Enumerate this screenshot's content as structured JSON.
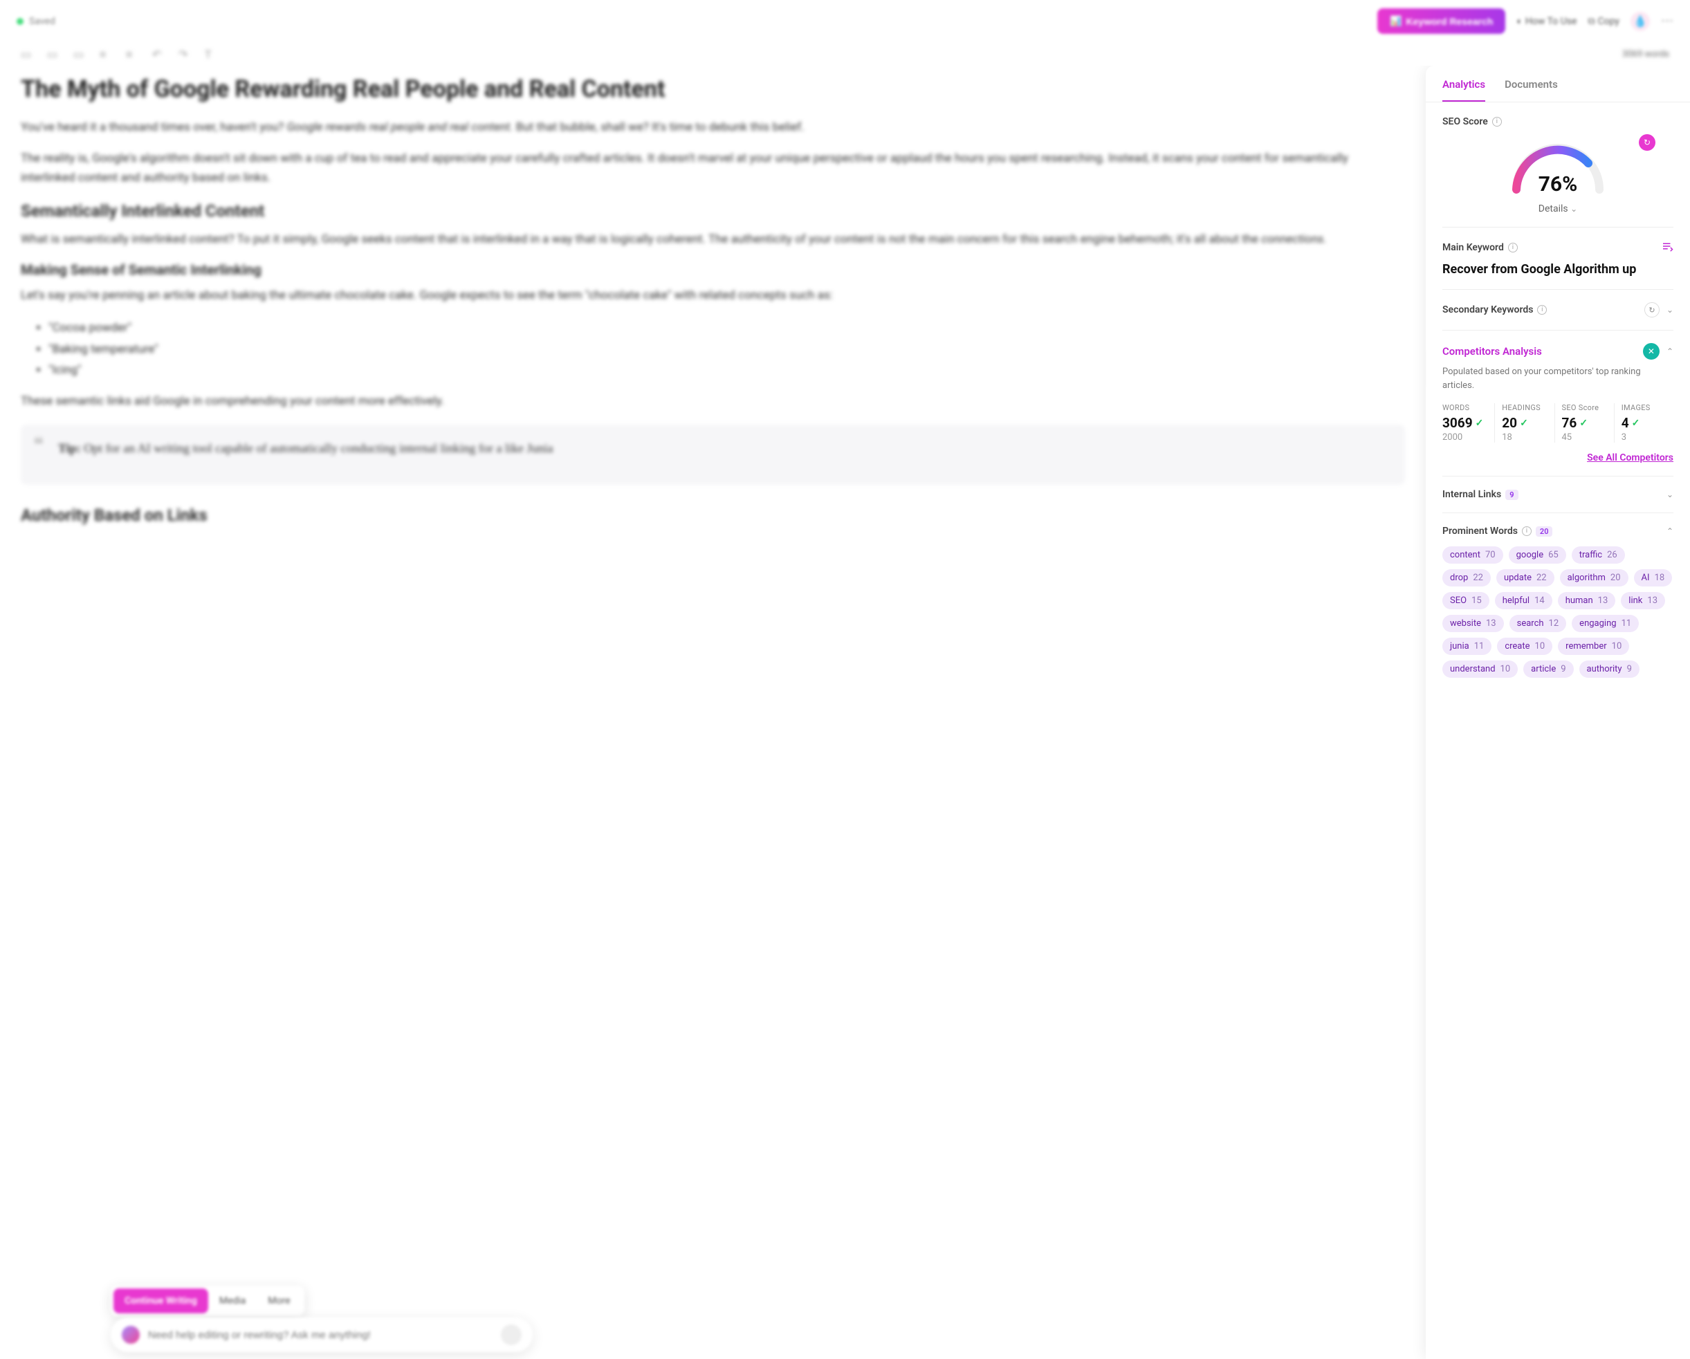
{
  "topbar": {
    "saved_label": "Saved",
    "keyword_research_label": "Keyword Research",
    "how_to_use_label": "How To Use",
    "copy_label": "Copy"
  },
  "toolbar": {
    "word_count": "3069 words"
  },
  "editor": {
    "title": "The Myth of Google Rewarding Real People and Real Content",
    "p1a": "You've heard it a thousand times over, haven't you? ",
    "p1b": "Google rewards real people and real content.",
    "p1c": " But that bubble, shall we? It's time to debunk this belief.",
    "p2": "The reality is, Google's algorithm doesn't sit down with a cup of tea to read and appreciate your carefully crafted articles. It doesn't marvel at your unique perspective or applaud the hours you spent researching. Instead, it scans your content for semantically interlinked content and authority based on links.",
    "h2a": "Semantically Interlinked Content",
    "p3a": "What is semantically interlinked content? To put it simply, Google seeks content that is interlinked in a way that is logically coherent. The authenticity of your content is not the main concern for this search engine behemoth; it's all about the ",
    "p3b": "connections.",
    "h3a": "Making Sense of Semantic Interlinking",
    "p4": "Let's say you're penning an article about baking the ultimate chocolate cake. Google expects to see the term \"chocolate cake\" with related concepts such as:",
    "li1": "\"Cocoa powder\"",
    "li2": "\"Baking temperature\"",
    "li3": "\"Icing\"",
    "p5": "These semantic links aid Google in comprehending your content more effectively.",
    "tip_label": "Tip:",
    "tip_body": " Opt for an AI writing tool capable of automatically conducting internal linking for a like Junia",
    "h2b": "Authority Based on Links"
  },
  "floating": {
    "continue": "Continue Writing",
    "media": "Media",
    "more": "More",
    "ask_placeholder": "Need help editing or rewriting? Ask me anything!"
  },
  "sidebar": {
    "tabs": {
      "analytics": "Analytics",
      "documents": "Documents"
    },
    "seo_score_label": "SEO Score",
    "seo_score_value": "76%",
    "details_label": "Details",
    "main_keyword_label": "Main Keyword",
    "main_keyword_value": "Recover from Google Algorithm up",
    "secondary_label": "Secondary Keywords",
    "competitors": {
      "title": "Competitors Analysis",
      "desc": "Populated based on your competitors' top ranking articles.",
      "stats": {
        "words": {
          "label": "WORDS",
          "value": "3069",
          "target": "2000"
        },
        "headings": {
          "label": "HEADINGS",
          "value": "20",
          "target": "18"
        },
        "seo": {
          "label": "SEO Score",
          "value": "76",
          "target": "45"
        },
        "images": {
          "label": "IMAGES",
          "value": "4",
          "target": "3"
        }
      },
      "see_all": "See All Competitors"
    },
    "internal_links": {
      "label": "Internal Links",
      "count": "9"
    },
    "prominent": {
      "label": "Prominent Words",
      "count": "20"
    },
    "chips": [
      {
        "w": "content",
        "c": "70"
      },
      {
        "w": "google",
        "c": "65"
      },
      {
        "w": "traffic",
        "c": "26"
      },
      {
        "w": "drop",
        "c": "22"
      },
      {
        "w": "update",
        "c": "22"
      },
      {
        "w": "algorithm",
        "c": "20"
      },
      {
        "w": "AI",
        "c": "18"
      },
      {
        "w": "SEO",
        "c": "15"
      },
      {
        "w": "helpful",
        "c": "14"
      },
      {
        "w": "human",
        "c": "13"
      },
      {
        "w": "link",
        "c": "13"
      },
      {
        "w": "website",
        "c": "13"
      },
      {
        "w": "search",
        "c": "12"
      },
      {
        "w": "engaging",
        "c": "11"
      },
      {
        "w": "junia",
        "c": "11"
      },
      {
        "w": "create",
        "c": "10"
      },
      {
        "w": "remember",
        "c": "10"
      },
      {
        "w": "understand",
        "c": "10"
      },
      {
        "w": "article",
        "c": "9"
      },
      {
        "w": "authority",
        "c": "9"
      }
    ]
  },
  "chart_data": {
    "type": "pie",
    "title": "SEO Score",
    "values": [
      76,
      24
    ],
    "categories": [
      "score",
      "remaining"
    ],
    "ylim": [
      0,
      100
    ]
  }
}
